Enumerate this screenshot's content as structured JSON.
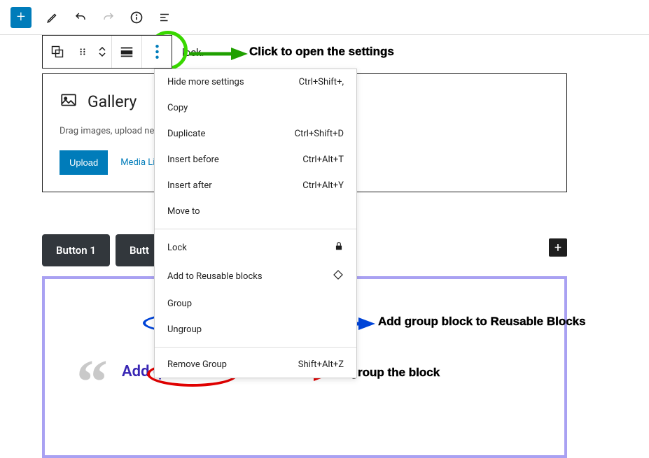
{
  "topbar": {},
  "editor": {
    "truncated_text": "lock.",
    "gallery": {
      "title": "Gallery",
      "description": "Drag images, upload new",
      "upload_label": "Upload",
      "media_library_label": "Media Lib"
    },
    "buttons": {
      "button1": "Button 1",
      "button2": "Butt"
    },
    "quote": {
      "placeholder": "Add q"
    }
  },
  "menu": {
    "hide_more": {
      "label": "Hide more settings",
      "shortcut": "Ctrl+Shift+,"
    },
    "copy": {
      "label": "Copy"
    },
    "duplicate": {
      "label": "Duplicate",
      "shortcut": "Ctrl+Shift+D"
    },
    "insert_before": {
      "label": "Insert before",
      "shortcut": "Ctrl+Alt+T"
    },
    "insert_after": {
      "label": "Insert after",
      "shortcut": "Ctrl+Alt+Y"
    },
    "move_to": {
      "label": "Move to"
    },
    "lock": {
      "label": "Lock"
    },
    "add_reusable": {
      "label": "Add to Reusable blocks"
    },
    "group": {
      "label": "Group"
    },
    "ungroup": {
      "label": "Ungroup"
    },
    "remove_group": {
      "label": "Remove Group",
      "shortcut": "Shift+Alt+Z"
    }
  },
  "annotations": {
    "open_settings": "Click to open the settings",
    "add_reusable": "Add group block to Reusable Blocks",
    "ungroup": "Ungroup the block"
  }
}
